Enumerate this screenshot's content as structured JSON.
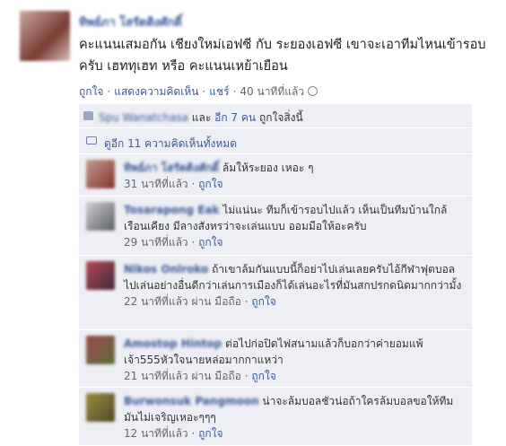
{
  "post": {
    "author": "ทิพย์ภา โสรัตติงศักดิ์",
    "text": "คะแนนเสมอกัน เชียงใหม่เอฟซี กับ ระยองเอฟซี เขาจะเอาทีมไหนเข้ารอบครับ เฮททุเฮท หรือ คะแนนเหย้าเยือน",
    "actions": {
      "like": "ถูกใจ",
      "comment": "แสดงความคิดเห็น",
      "share": "แชร์",
      "time": "40 นาทีที่แล้ว"
    }
  },
  "likes": {
    "name": "Spu Wanatchasa",
    "rest": "และ",
    "others": "อีก 7 คน",
    "suffix": "ถูกใจสิ่งนี้"
  },
  "view_all": "ดูอีก 11 ความคิดเห็นทั้งหมด",
  "comments": [
    {
      "name": "ทิพย์ภา โสรัตติงศักดิ์",
      "text": "ล้มให้ระยอง เหอะ ๆ",
      "time": "31 นาทีที่แล้ว",
      "via": "",
      "like": "ถูกใจ"
    },
    {
      "name": "Tosarapong Eak",
      "text": "ไม่แน่นะ ทีมก็เข้ารอบไปแล้ว เห็นเป็นทีมบ้านใกล้เรือนเคียง มีลางสังหรว่าจะเล่นแบบ ออมมือให้อะครับ",
      "time": "29 นาทีที่แล้ว",
      "via": "",
      "like": "ถูกใจ"
    },
    {
      "name": "Nikos Onlroko",
      "text": "ถ้าเขาล้มกันแบบนี้ก็อย่าไปเล่นเลยครับไอ้กีฬาฟุตบอลไปเล่นอย่างอื่นดีกว่าเล่นการเมืองก็ได้เล่นอะไรที่มันสกปรกดนิดมากกว่ามั้ง",
      "time": "22 นาทีที่แล้ว",
      "via": "ผ่าน มือถือ",
      "like": "ถูกใจ"
    },
    {
      "name": "Amostop Hintop",
      "text": "ต่อไปก่อปิดไฟสนามแล้วก็บอกว่าค่ายอมแพ้เจ้า555หัวใจนายหล่อมากกาแหว่า",
      "time": "21 นาทีที่แล้ว",
      "via": "ผ่าน มือถือ",
      "like": "ถูกใจ"
    },
    {
      "name": "Burwonsuk Pangmoon",
      "text": "น่าจะล้มบอลชัวน่อถ้าใครล้มบอลขอให้ทีมมันไม่เจริญเหอะๆๆๆ",
      "time": "12 นาทีที่แล้ว",
      "via": "",
      "like": "ถูกใจ"
    }
  ]
}
